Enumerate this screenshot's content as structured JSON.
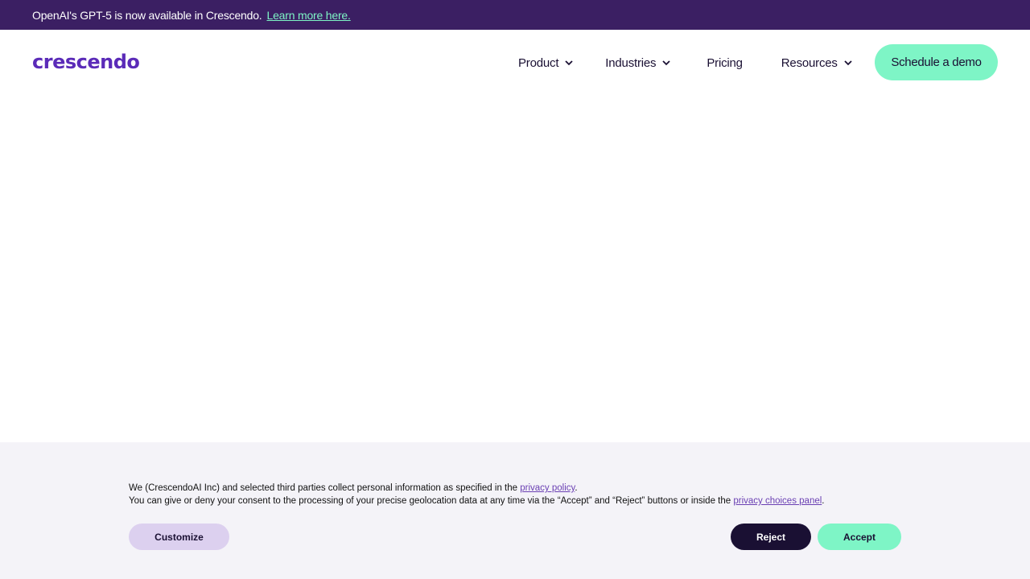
{
  "announcement": {
    "message": "OpenAI's GPT-5 is now available in Crescendo.",
    "link": "Learn more here."
  },
  "header": {
    "logo": "crescendo",
    "menu": [
      {
        "label": "Product",
        "has_dropdown": true
      },
      {
        "label": "Industries",
        "has_dropdown": true
      },
      {
        "label": "Pricing",
        "has_dropdown": false
      },
      {
        "label": "Resources",
        "has_dropdown": true
      }
    ],
    "cta": "Schedule a demo"
  },
  "cookie_banner": {
    "line1_prefix": "We (CrescendoAI Inc) and selected third parties collect personal information as specified in the ",
    "line1_link": "privacy policy",
    "line1_suffix": ".",
    "line2_prefix": "You can give or deny your consent to the processing of your precise geolocation data at any time via the “Accept” and “Reject” buttons or inside the ",
    "line2_link": "privacy choices panel",
    "line2_suffix": ".",
    "customize": "Customize",
    "reject": "Reject",
    "accept": "Accept"
  },
  "colors": {
    "announce_bg": "#3b1f63",
    "brand_purple": "#5b2bb8",
    "accent_mint": "#7ef5c6",
    "dark": "#1a1033"
  }
}
